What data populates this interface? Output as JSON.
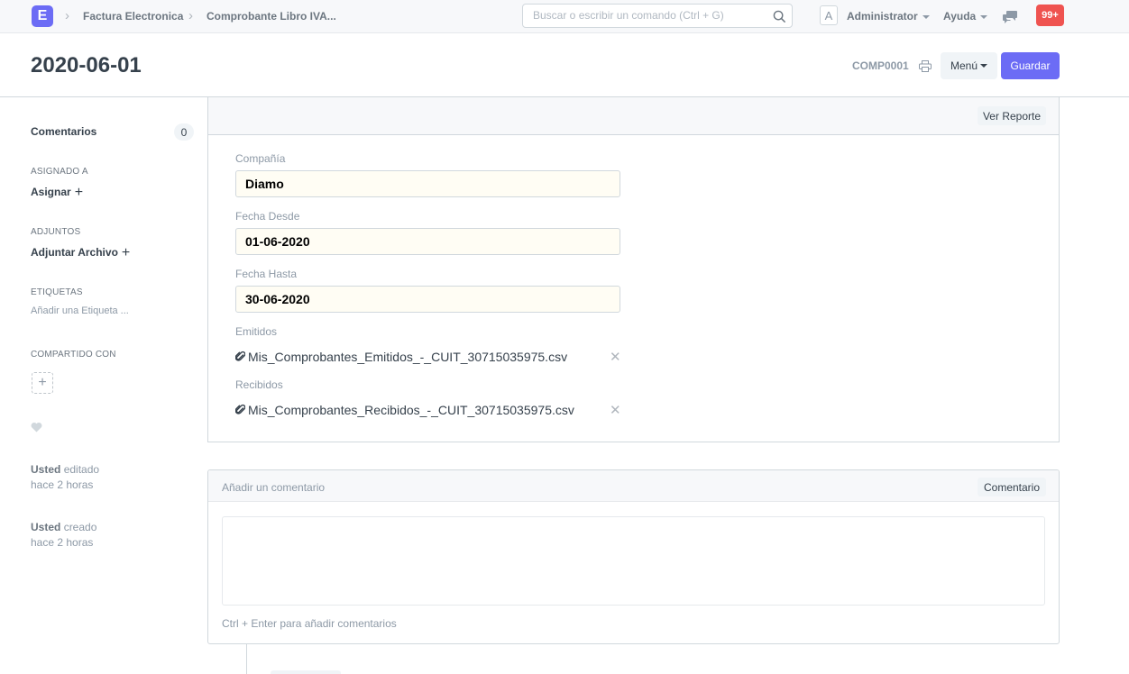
{
  "navbar": {
    "logo_letter": "E",
    "breadcrumbs": [
      "Factura Electronica",
      "Comprobante Libro IVA..."
    ],
    "search": {
      "placeholder": "Buscar o escribir un comando (Ctrl + G)",
      "value": ""
    },
    "avatar_letter": "A",
    "user_menu": "Administrator",
    "help_menu": "Ayuda",
    "notifications": "99+",
    "icons": [
      "search-icon",
      "chat-icon"
    ],
    "accent_color": "#6c6cf5",
    "badge_color": "#ef5350"
  },
  "page": {
    "title": "2020-06-01",
    "doc_id": "COMP0001",
    "menu_button": "Menú",
    "save_button": "Guardar"
  },
  "sidebar": {
    "comments_label": "Comentarios",
    "comments_count": "0",
    "assigned_heading": "Asignado a",
    "assign_label": "Asignar",
    "attachments_heading": "Adjuntos",
    "attach_label": "Adjuntar Archivo",
    "tags_heading": "Etiquetas",
    "tags_placeholder": "Añadir una Etiqueta ...",
    "shared_heading": "Compartido con",
    "activity": [
      {
        "user": "Usted",
        "action": "editado",
        "time": "hace 2 horas"
      },
      {
        "user": "Usted",
        "action": "creado",
        "time": "hace 2 horas"
      }
    ]
  },
  "form": {
    "report_button": "Ver Reporte",
    "fields": [
      {
        "label": "Compañía",
        "value": "Diamo"
      },
      {
        "label": "Fecha Desde",
        "value": "01-06-2020"
      },
      {
        "label": "Fecha Hasta",
        "value": "30-06-2020"
      }
    ],
    "attachments": [
      {
        "label": "Emitidos",
        "file": "Mis_Comprobantes_Emitidos_-_CUIT_30715035975.csv"
      },
      {
        "label": "Recibidos",
        "file": "Mis_Comprobantes_Recibidos_-_CUIT_30715035975.csv"
      }
    ]
  },
  "comment": {
    "title": "Añadir un comentario",
    "button": "Comentario",
    "hint": "Ctrl + Enter para añadir comentarios"
  }
}
